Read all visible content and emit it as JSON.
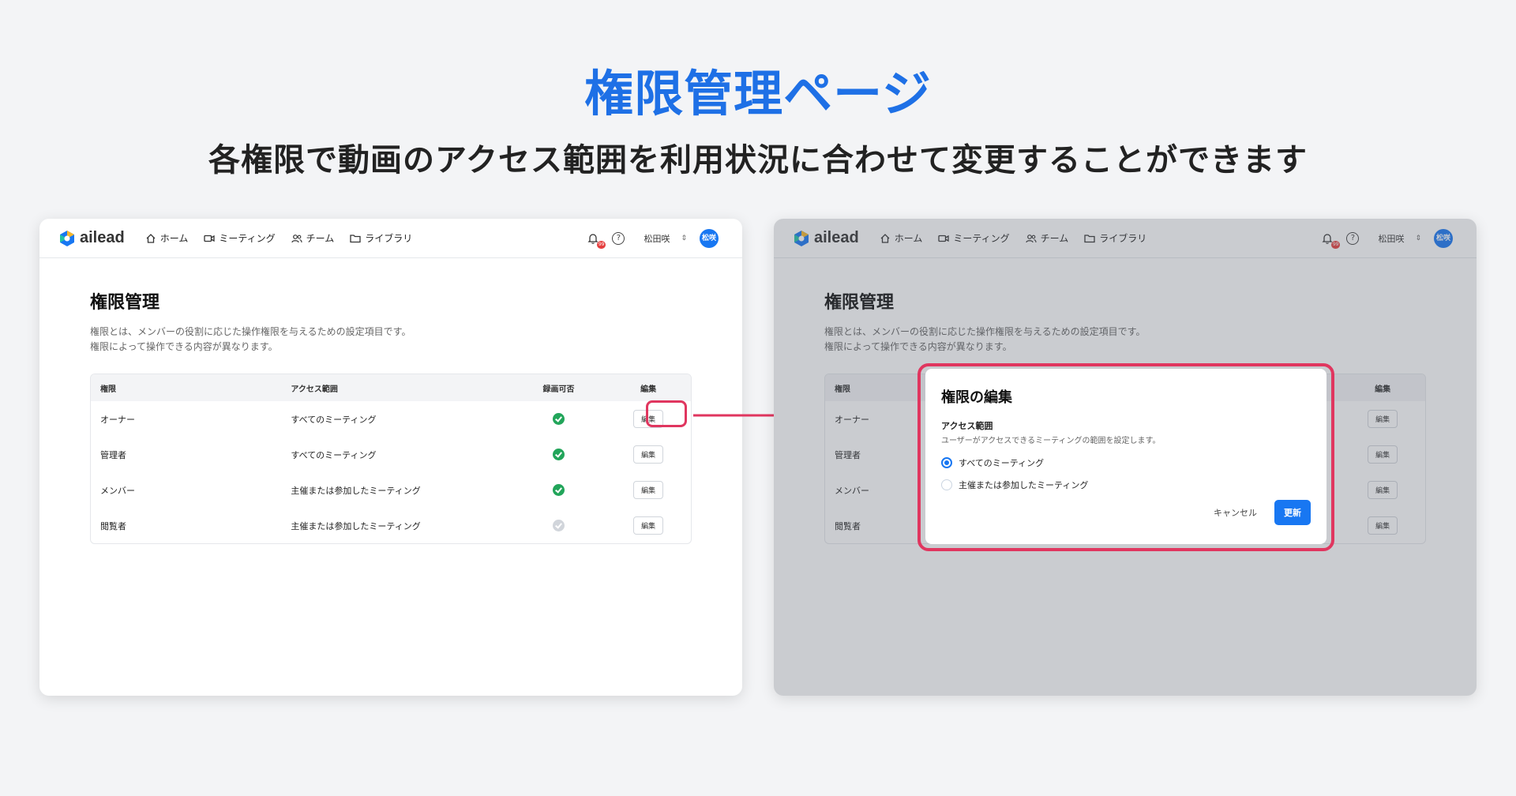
{
  "headline": "権限管理ページ",
  "subheadline": "各権限で動画のアクセス範囲を利用状況に合わせて変更することができます",
  "app": {
    "logo_text": "ailead",
    "nav": [
      "ホーム",
      "ミーティング",
      "チーム",
      "ライブラリ"
    ],
    "notification_count": "99",
    "help_icon": "?",
    "user_name": "松田咲",
    "avatar_initials": "松咲",
    "colors": {
      "accent": "#1877f2",
      "highlight": "#e0365f",
      "check_on": "#22a55a",
      "check_off": "#d1d5db"
    }
  },
  "page": {
    "title": "権限管理",
    "description_line1": "権限とは、メンバーの役割に応じた操作権限を与えるための設定項目です。",
    "description_line2": "権限によって操作できる内容が異なります。"
  },
  "table": {
    "headers": [
      "権限",
      "アクセス範囲",
      "録画可否",
      "編集"
    ],
    "rows": [
      {
        "role": "オーナー",
        "scope": "すべてのミーティング",
        "recording": true,
        "edit": "編集"
      },
      {
        "role": "管理者",
        "scope": "すべてのミーティング",
        "recording": true,
        "edit": "編集"
      },
      {
        "role": "メンバー",
        "scope": "主催または参加したミーティング",
        "recording": true,
        "edit": "編集"
      },
      {
        "role": "閲覧者",
        "scope": "主催または参加したミーティング",
        "recording": false,
        "edit": "編集"
      }
    ]
  },
  "modal": {
    "title": "権限の編集",
    "field_label": "アクセス範囲",
    "field_help": "ユーザーがアクセスできるミーティングの範囲を設定します。",
    "options": [
      "すべてのミーティング",
      "主催または参加したミーティング"
    ],
    "selected_option": "すべてのミーティング",
    "cancel": "キャンセル",
    "submit": "更新"
  }
}
